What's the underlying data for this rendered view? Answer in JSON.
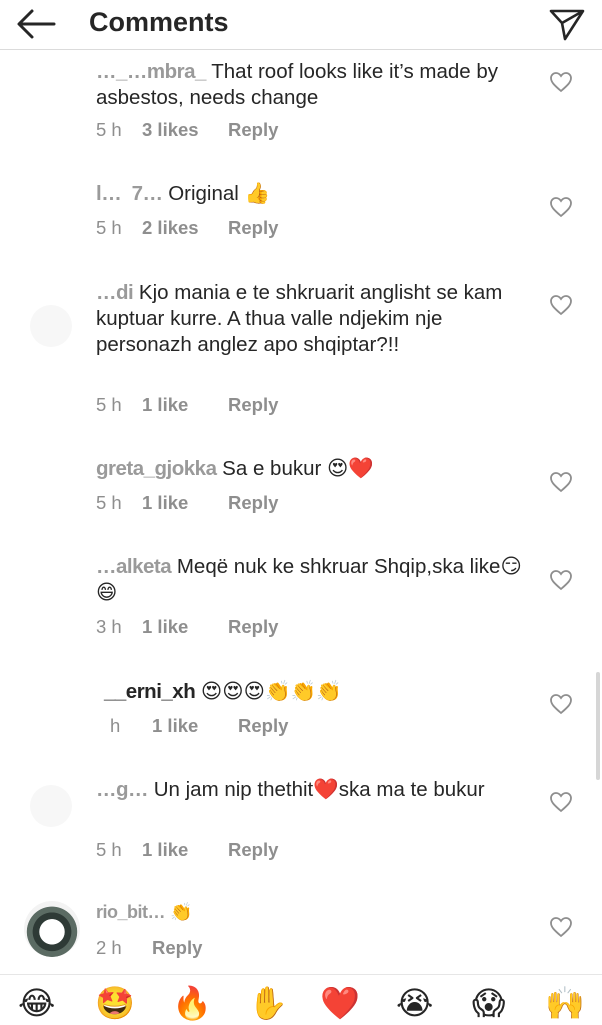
{
  "header": {
    "title": "Comments"
  },
  "comments": [
    {
      "username": "…_…mbra_",
      "text": " That roof looks like it’s made by asbestos, needs change",
      "time": "5 h",
      "likes": "3 likes",
      "reply": "Reply"
    },
    {
      "username": "l…  7…",
      "text": " Original 👍",
      "time": "5 h",
      "likes": "2 likes",
      "reply": "Reply"
    },
    {
      "username": "…di",
      "text": " Kjo mania e te shkruarit anglisht se kam kuptuar kurre. A thua valle ndjekim nje personazh anglez apo shqiptar?!!",
      "time": "5 h",
      "likes": "1 like",
      "reply": "Reply"
    },
    {
      "username": "greta_gjokka",
      "text": " Sa e bukur 😍❤️",
      "time": "5 h",
      "likes": "1 like",
      "reply": "Reply"
    },
    {
      "username": "…alketa",
      "text": " Meqë nuk ke shkruar Shqip,ska like😏😄",
      "time": "3 h",
      "likes": "1 like",
      "reply": "Reply"
    },
    {
      "username": "__erni_xh",
      "text": " 😍😍😍👏👏👏",
      "time": "h",
      "likes": "1 like",
      "reply": "Reply"
    },
    {
      "username": "…g…",
      "text": " Un jam nip thethit❤️ska ma te bukur",
      "time": "5 h",
      "likes": "1 like",
      "reply": "Reply"
    },
    {
      "username": "rio_bit…",
      "text": " 👏",
      "time": "2 h",
      "likes": "",
      "reply": "Reply"
    }
  ],
  "emoji_bar": [
    "😂",
    "🤩",
    "🔥",
    "✋",
    "❤️",
    "😭",
    "😱",
    "🙌"
  ],
  "colors": {
    "text": "#262626",
    "meta": "#8e8e8e",
    "divider": "#dbdbdb"
  }
}
